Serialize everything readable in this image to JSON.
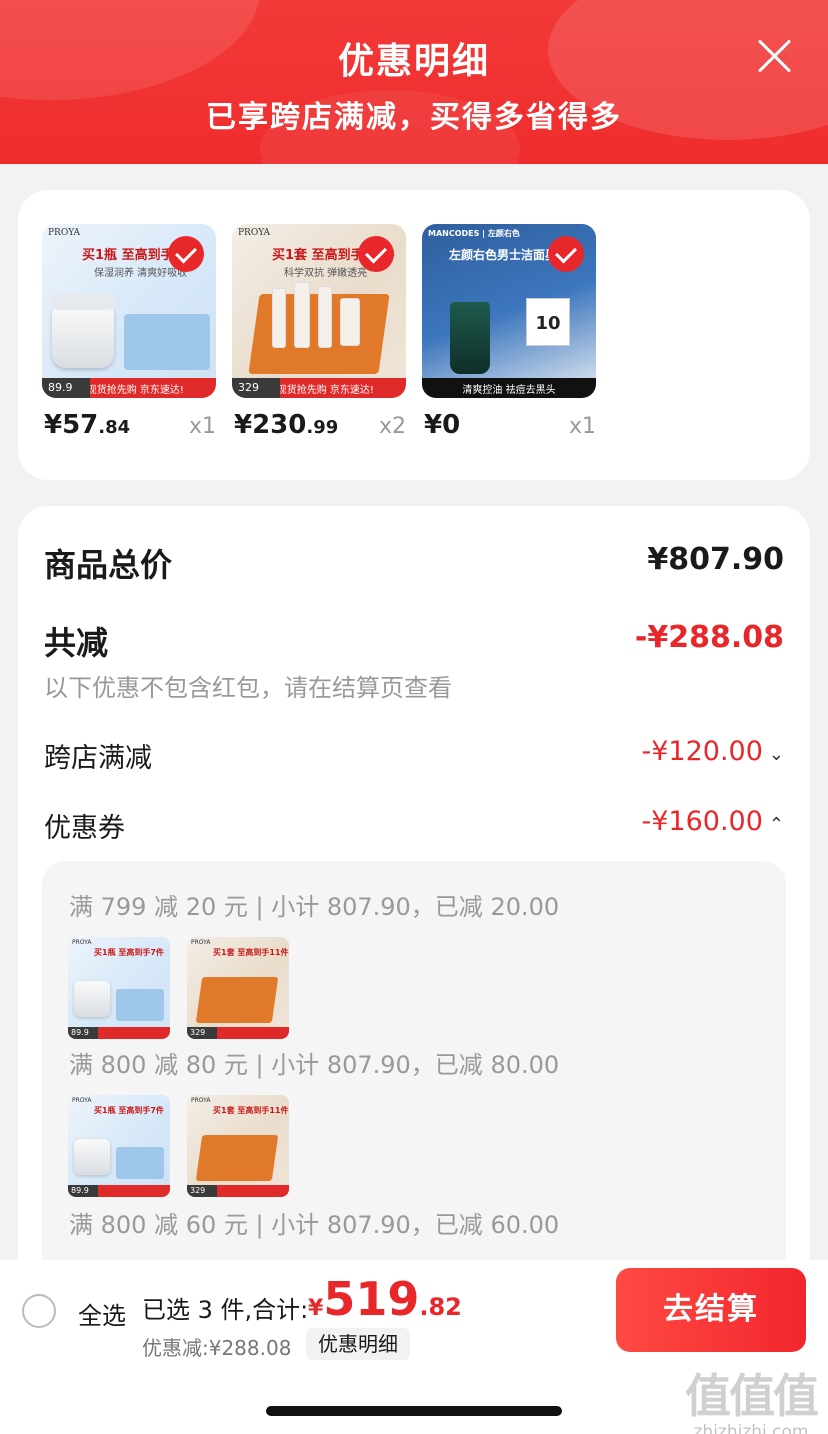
{
  "header": {
    "title": "优惠明细",
    "subtitle": "已享跨店满减，买得多省得多"
  },
  "products": [
    {
      "brand": "PROYA",
      "promo": "买1瓶 至高到手7件",
      "promo_sub": "保湿润养 清爽好吸收",
      "thumb_price": "89.9",
      "thumb_bar": "38现货抢先购 京东速达!",
      "price_int": "¥57",
      "price_dec": ".84",
      "qty": "x1"
    },
    {
      "brand": "PROYA",
      "promo": "买1套 至高到手11件",
      "promo_sub": "科学双抗 弹嫩透亮",
      "thumb_price": "329",
      "thumb_bar": "38现货抢先购 京东速达!",
      "price_int": "¥230",
      "price_dec": ".99",
      "qty": "x2"
    },
    {
      "brand": "MANCODES | 左颜右色",
      "promo": "左颜右色男士洁面星品",
      "promo_sub": "",
      "coupon_num": "10",
      "thumb_bar": "清爽控油 祛痘去黑头",
      "price_int": "¥0",
      "price_dec": "",
      "qty": "x1"
    }
  ],
  "summary": {
    "total_label": "商品总价",
    "total_value": "¥807.90",
    "reduce_label": "共减",
    "reduce_value": "-¥288.08",
    "note": "以下优惠不包含红包，请在结算页查看",
    "cross_store_label": "跨店满减",
    "cross_store_value": "-¥120.00",
    "coupon_label": "优惠券",
    "coupon_value": "-¥160.00"
  },
  "coupon_details": [
    {
      "text": "满 799 减 20 元 | 小计 807.90，已减 20.00"
    },
    {
      "text": "满 800 减 80 元 | 小计 807.90，已减 80.00"
    },
    {
      "text": "满 800 减 60 元 | 小计 807.90，已减 60.00"
    }
  ],
  "mini_thumbs": {
    "a_price": "89.9",
    "b_price": "329",
    "a_text": "买1瓶 至高到手7件",
    "b_text": "买1套 至高到手11件",
    "brand": "PROYA"
  },
  "footer": {
    "select_all": "全选",
    "selected_text": "已选 3 件,合计:",
    "total_currency": "¥",
    "total_int": "519",
    "total_dec": ".82",
    "discount_text": "优惠减:¥288.08",
    "detail_chip": "优惠明细",
    "checkout": "去结算"
  },
  "watermark": {
    "logo": "值值值",
    "url": "zhizhizhi.com"
  },
  "colors": {
    "accent_red": "#e8272b",
    "header_red": "#ef2c2d"
  }
}
